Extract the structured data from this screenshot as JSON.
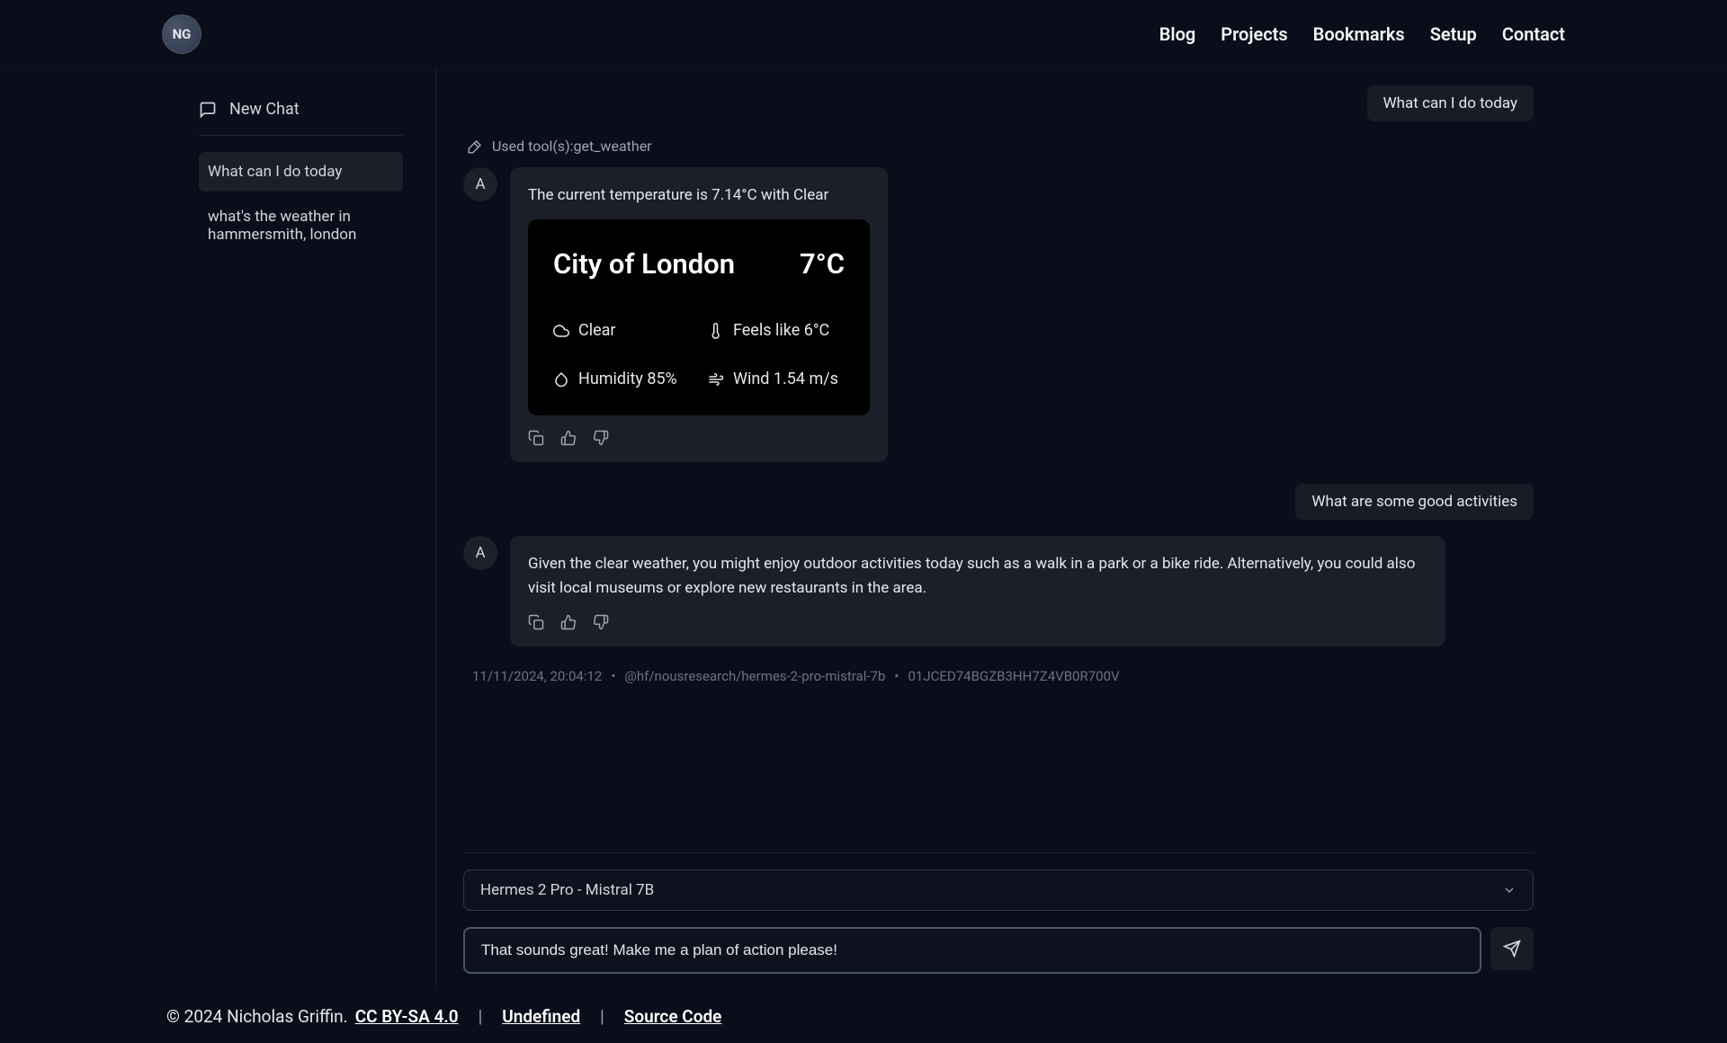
{
  "header": {
    "logo_text": "NG",
    "nav": [
      "Blog",
      "Projects",
      "Bookmarks",
      "Setup",
      "Contact"
    ]
  },
  "sidebar": {
    "new_chat_label": "New Chat",
    "items": [
      {
        "label": "What can I do today",
        "active": true
      },
      {
        "label": "what's the weather in hammersmith, london",
        "active": false
      }
    ]
  },
  "conversation": {
    "user_messages": [
      "What can I do today",
      "What are some good activities"
    ],
    "tool_use": "Used tool(s):get_weather",
    "assistant_messages": [
      {
        "text": "The current temperature is 7.14°C with Clear",
        "weather": {
          "city": "City of London",
          "temp": "7°C",
          "condition": "Clear",
          "feels_like": "Feels like 6°C",
          "humidity": "Humidity 85%",
          "wind": "Wind 1.54 m/s"
        }
      },
      {
        "text": "Given the clear weather, you might enjoy outdoor activities today such as a walk in a park or a bike ride. Alternatively, you could also visit local museums or explore new restaurants in the area."
      }
    ],
    "avatar_label": "A",
    "meta": {
      "timestamp": "11/11/2024, 20:04:12",
      "model": "@hf/nousresearch/hermes-2-pro-mistral-7b",
      "id": "01JCED74BGZB3HH7Z4VB0R700V"
    }
  },
  "input": {
    "model_label": "Hermes 2 Pro - Mistral 7B",
    "value": "That sounds great! Make me a plan of action please!"
  },
  "footer": {
    "copyright": "© 2024 Nicholas Griffin.",
    "license": "CC BY-SA 4.0",
    "undefined_label": "Undefined",
    "source_code": "Source Code"
  }
}
